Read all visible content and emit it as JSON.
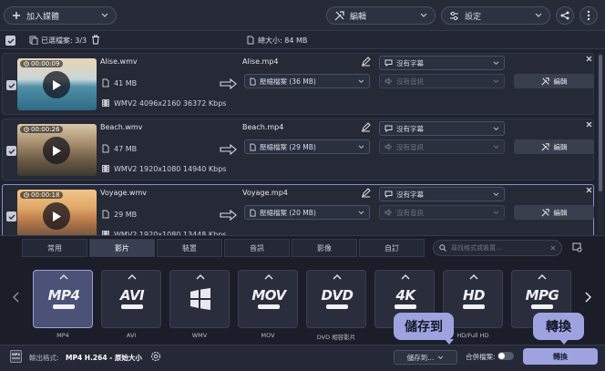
{
  "toolbar": {
    "add_media": "加入媒體",
    "edit": "編輯",
    "settings": "設定"
  },
  "infobar": {
    "selected": "已選檔案: 3/3",
    "total_size": "總大小: 84 MB"
  },
  "files": [
    {
      "duration": "00:00:09",
      "name": "Alise.wmv",
      "size": "41 MB",
      "meta": "WMV2 4096x2160 36372 Kbps",
      "output_name": "Alise.mp4",
      "output_size": "壓縮檔案 (36 MB)",
      "subtitle": "沒有字幕",
      "audio": "沒有音訊",
      "edit": "編輯"
    },
    {
      "duration": "00:00:26",
      "name": "Beach.wmv",
      "size": "47 MB",
      "meta": "WMV2 1920x1080 14940 Kbps",
      "output_name": "Beach.mp4",
      "output_size": "壓縮檔案 (29 MB)",
      "subtitle": "沒有字幕",
      "audio": "沒有音訊",
      "edit": "編輯"
    },
    {
      "duration": "00:00:18",
      "name": "Voyage.wmv",
      "size": "29 MB",
      "meta": "WMV2 1920x1080 13448 Kbps",
      "output_name": "Voyage.mp4",
      "output_size": "壓縮檔案 (20 MB)",
      "subtitle": "沒有字幕",
      "audio": "沒有音訊",
      "edit": "編輯"
    }
  ],
  "tabs": [
    "常用",
    "影片",
    "裝置",
    "音訊",
    "影像",
    "自訂"
  ],
  "active_tab": "影片",
  "search_placeholder": "尋找格式或裝置...",
  "formats": [
    {
      "logo": "MP4",
      "label": "MP4"
    },
    {
      "logo": "AVI",
      "label": "AVI"
    },
    {
      "logo": "",
      "label": "WMV"
    },
    {
      "logo": "MOV",
      "label": "MOV"
    },
    {
      "logo": "DVD",
      "label": "DVD 相容影片"
    },
    {
      "logo": "4K",
      "label": "4K"
    },
    {
      "logo": "HD",
      "label": "HD/Full HD"
    },
    {
      "logo": "MPG",
      "label": "MPG"
    }
  ],
  "bottom": {
    "output_format_label": "輸出格式:",
    "output_format_value": "MP4 H.264 - 原始大小",
    "save_to": "儲存到...",
    "merge": "合併檔案:",
    "convert": "轉換"
  },
  "callouts": {
    "save": "儲存到",
    "convert": "轉換"
  },
  "colors": {
    "accent": "#9ea3e0",
    "background": "#1f2330"
  }
}
